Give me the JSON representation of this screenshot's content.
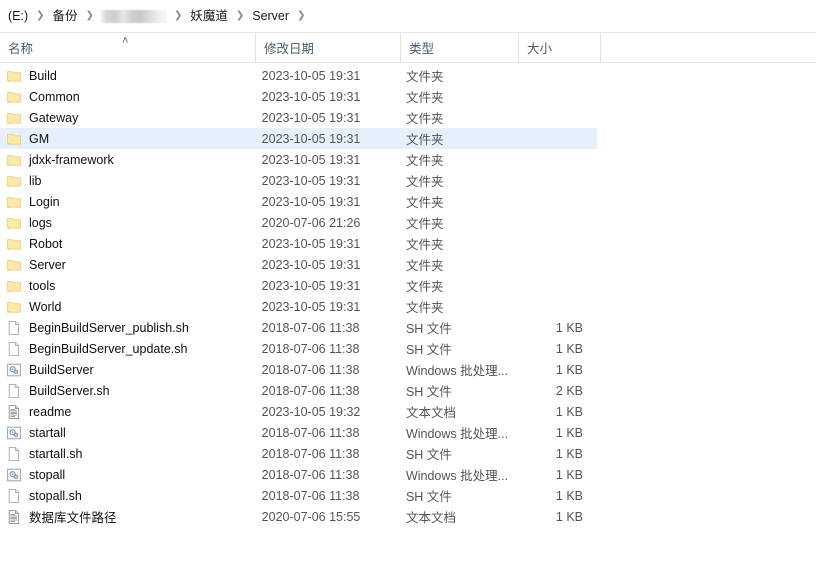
{
  "window": {
    "title": "Server"
  },
  "breadcrumb": {
    "separator": "❯",
    "items": [
      {
        "label": "(E:)",
        "redacted": false
      },
      {
        "label": "备份",
        "redacted": false
      },
      {
        "label": "",
        "redacted": true
      },
      {
        "label": "妖魔道",
        "redacted": false
      },
      {
        "label": "Server",
        "redacted": false
      }
    ]
  },
  "columns": {
    "name": "名称",
    "date": "修改日期",
    "type": "类型",
    "size": "大小",
    "sort_indicator": "˄",
    "sort_column": "name",
    "sort_direction": "ascending"
  },
  "colors": {
    "selection": "#e4f0fb",
    "folder_icon": "#fbe39a",
    "header_text": "#4a5b70",
    "meta_text": "#555555"
  },
  "files": [
    {
      "name": "Build",
      "icon": "folder-icon",
      "date": "2023-10-05 19:31",
      "type": "文件夹",
      "size": "",
      "selected": false
    },
    {
      "name": "Common",
      "icon": "folder-icon",
      "date": "2023-10-05 19:31",
      "type": "文件夹",
      "size": "",
      "selected": false
    },
    {
      "name": "Gateway",
      "icon": "folder-icon",
      "date": "2023-10-05 19:31",
      "type": "文件夹",
      "size": "",
      "selected": false
    },
    {
      "name": "GM",
      "icon": "folder-icon",
      "date": "2023-10-05 19:31",
      "type": "文件夹",
      "size": "",
      "selected": true
    },
    {
      "name": "jdxk-framework",
      "icon": "folder-icon",
      "date": "2023-10-05 19:31",
      "type": "文件夹",
      "size": "",
      "selected": false
    },
    {
      "name": "lib",
      "icon": "folder-icon",
      "date": "2023-10-05 19:31",
      "type": "文件夹",
      "size": "",
      "selected": false
    },
    {
      "name": "Login",
      "icon": "folder-icon",
      "date": "2023-10-05 19:31",
      "type": "文件夹",
      "size": "",
      "selected": false
    },
    {
      "name": "logs",
      "icon": "folder-icon",
      "date": "2020-07-06 21:26",
      "type": "文件夹",
      "size": "",
      "selected": false
    },
    {
      "name": "Robot",
      "icon": "folder-icon",
      "date": "2023-10-05 19:31",
      "type": "文件夹",
      "size": "",
      "selected": false
    },
    {
      "name": "Server",
      "icon": "folder-icon",
      "date": "2023-10-05 19:31",
      "type": "文件夹",
      "size": "",
      "selected": false
    },
    {
      "name": "tools",
      "icon": "folder-icon",
      "date": "2023-10-05 19:31",
      "type": "文件夹",
      "size": "",
      "selected": false
    },
    {
      "name": "World",
      "icon": "folder-icon",
      "date": "2023-10-05 19:31",
      "type": "文件夹",
      "size": "",
      "selected": false
    },
    {
      "name": "BeginBuildServer_publish.sh",
      "icon": "blank-document-icon",
      "date": "2018-07-06 11:38",
      "type": "SH 文件",
      "size": "1 KB",
      "selected": false
    },
    {
      "name": "BeginBuildServer_update.sh",
      "icon": "blank-document-icon",
      "date": "2018-07-06 11:38",
      "type": "SH 文件",
      "size": "1 KB",
      "selected": false
    },
    {
      "name": "BuildServer",
      "icon": "batch-file-icon",
      "date": "2018-07-06 11:38",
      "type": "Windows 批处理...",
      "size": "1 KB",
      "selected": false
    },
    {
      "name": "BuildServer.sh",
      "icon": "blank-document-icon",
      "date": "2018-07-06 11:38",
      "type": "SH 文件",
      "size": "2 KB",
      "selected": false
    },
    {
      "name": "readme",
      "icon": "text-document-icon",
      "date": "2023-10-05 19:32",
      "type": "文本文档",
      "size": "1 KB",
      "selected": false
    },
    {
      "name": "startall",
      "icon": "batch-file-icon",
      "date": "2018-07-06 11:38",
      "type": "Windows 批处理...",
      "size": "1 KB",
      "selected": false
    },
    {
      "name": "startall.sh",
      "icon": "blank-document-icon",
      "date": "2018-07-06 11:38",
      "type": "SH 文件",
      "size": "1 KB",
      "selected": false
    },
    {
      "name": "stopall",
      "icon": "batch-file-icon",
      "date": "2018-07-06 11:38",
      "type": "Windows 批处理...",
      "size": "1 KB",
      "selected": false
    },
    {
      "name": "stopall.sh",
      "icon": "blank-document-icon",
      "date": "2018-07-06 11:38",
      "type": "SH 文件",
      "size": "1 KB",
      "selected": false
    },
    {
      "name": "数据库文件路径",
      "icon": "text-document-icon",
      "date": "2020-07-06 15:55",
      "type": "文本文档",
      "size": "1 KB",
      "selected": false
    }
  ]
}
